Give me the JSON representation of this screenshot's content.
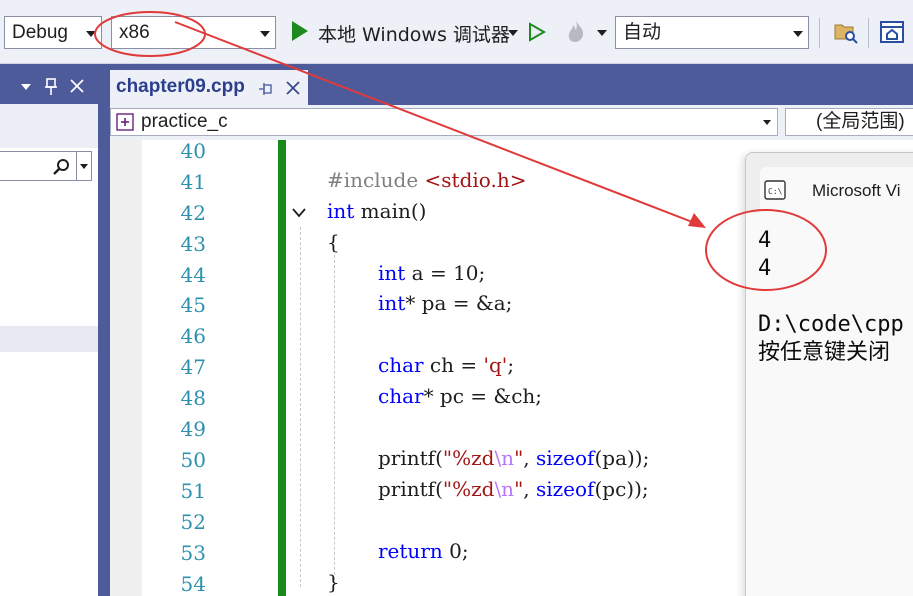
{
  "toolbar": {
    "config": "Debug",
    "platform": "x86",
    "run_label": "本地 Windows 调试器",
    "solution_config": "自动",
    "colors": {
      "run_green": "#1f8a1f",
      "accent_blue": "#4d5b9a"
    }
  },
  "editor": {
    "tab_title": "chapter09.cpp",
    "scope_left": "practice_c",
    "scope_right": "(全局范围)",
    "lines": [
      {
        "num": "40"
      },
      {
        "num": "41"
      },
      {
        "num": "42"
      },
      {
        "num": "43"
      },
      {
        "num": "44"
      },
      {
        "num": "45"
      },
      {
        "num": "46"
      },
      {
        "num": "47"
      },
      {
        "num": "48"
      },
      {
        "num": "49"
      },
      {
        "num": "50"
      },
      {
        "num": "51"
      },
      {
        "num": "52"
      },
      {
        "num": "53"
      },
      {
        "num": "54"
      }
    ],
    "code": {
      "l41_pp": "#include ",
      "l41_hdr": "<stdio.h>",
      "l42_kw": "int",
      "l42_rest": " main()",
      "l43": "{",
      "l44_kw": "int",
      "l44_rest": " a = 10;",
      "l45_kw": "int",
      "l45_rest": "* pa = &a;",
      "l47_kw": "char",
      "l47_mid": " ch = ",
      "l47_str": "'q'",
      "l47_end": ";",
      "l48_kw": "char",
      "l48_rest": "* pc = &ch;",
      "l50_fn": "printf(",
      "l50_str1": "\"%zd",
      "l50_esc": "\\n",
      "l50_str2": "\"",
      "l50_mid": ", ",
      "l50_kw": "sizeof",
      "l50_end": "(pa));",
      "l51_fn": "printf(",
      "l51_str1": "\"%zd",
      "l51_esc": "\\n",
      "l51_str2": "\"",
      "l51_mid": ", ",
      "l51_kw": "sizeof",
      "l51_end": "(pc));",
      "l53_kw": "return",
      "l53_rest": " 0;",
      "l54": "}"
    }
  },
  "console": {
    "title": "Microsoft Vi",
    "output": [
      "4",
      "4",
      "",
      "D:\\code\\cpp",
      "按任意键关闭"
    ]
  },
  "annotation": {
    "color": "#e03a3a"
  }
}
